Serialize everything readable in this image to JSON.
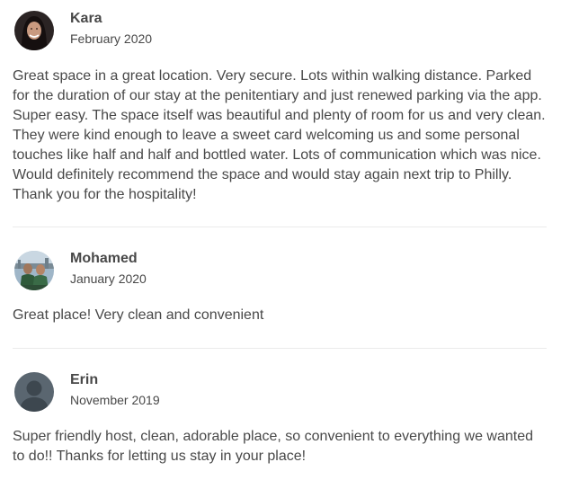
{
  "reviews": [
    {
      "name": "Kara",
      "date": "February 2020",
      "text": "Great space in a great location. Very secure. Lots within walking distance. Parked for the duration of our stay at the penitentiary and just renewed parking via the app. Super easy. The space itself was beautiful and plenty of room for us and very clean. They were kind enough to leave a sweet card welcoming us and some personal touches like half and half and bottled water. Lots of communication which was nice. Would definitely recommend the space and would stay again next trip to Philly. Thank you for the hospitality!",
      "avatar_icon": "user-photo-icon"
    },
    {
      "name": "Mohamed",
      "date": "January 2020",
      "text": "Great place! Very clean and convenient",
      "avatar_icon": "user-photo-icon"
    },
    {
      "name": "Erin",
      "date": "November 2019",
      "text": "Super friendly host, clean, adorable place, so convenient to everything we wanted to do!! Thanks for letting us stay in your place!",
      "avatar_icon": "default-user-icon"
    }
  ],
  "colors": {
    "text": "#484848",
    "divider": "#ebebeb",
    "default_avatar_bg": "#5a6670"
  }
}
